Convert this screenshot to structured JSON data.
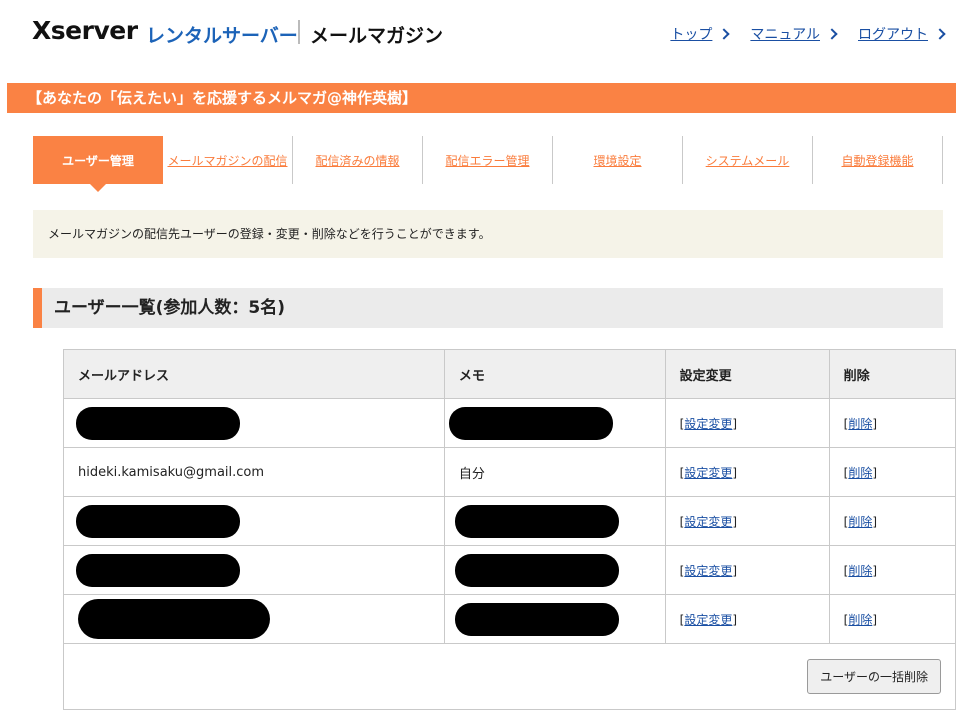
{
  "header": {
    "logo_brand": "Xserver",
    "logo_service": "レンタルサーバー",
    "app_title": "メールマガジン",
    "nav": [
      {
        "label": "トップ"
      },
      {
        "label": "マニュアル"
      },
      {
        "label": "ログアウト"
      }
    ]
  },
  "banner": {
    "title": "【あなたの「伝えたい」を応援するメルマガ@神作英樹】"
  },
  "tabs": [
    {
      "label": "ユーザー管理",
      "active": true
    },
    {
      "label": "メールマガジンの配信"
    },
    {
      "label": "配信済みの情報"
    },
    {
      "label": "配信エラー管理"
    },
    {
      "label": "環境設定"
    },
    {
      "label": "システムメール"
    },
    {
      "label": "自動登録機能"
    }
  ],
  "description": "メールマガジンの配信先ユーザーの登録・変更・削除などを行うことができます。",
  "section": {
    "title": "ユーザー一覧(参加人数：5名)"
  },
  "table": {
    "headers": [
      "メールアドレス",
      "メモ",
      "設定変更",
      "削除"
    ],
    "edit_label": "設定変更",
    "delete_label": "削除",
    "rows": [
      {
        "email": "",
        "memo": "",
        "redacted": true
      },
      {
        "email": "hideki.kamisaku@gmail.com",
        "memo": "自分",
        "redacted": false
      },
      {
        "email": "",
        "memo": "",
        "redacted": true
      },
      {
        "email": "",
        "memo": "",
        "redacted": true
      },
      {
        "email": "",
        "memo": "",
        "redacted": true
      }
    ],
    "bulk_delete_label": "ユーザーの一括削除"
  },
  "colors": {
    "accent": "#fa8244",
    "link": "#1a4fa3",
    "description_bg": "#f5f3e8"
  }
}
